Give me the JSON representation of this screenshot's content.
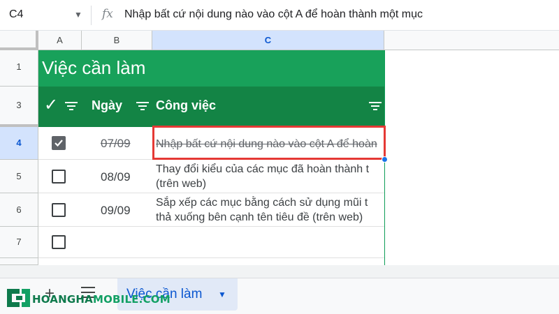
{
  "formula_bar": {
    "cell_ref": "C4",
    "fx_symbol": "fx",
    "content": "Nhập bất cứ nội dung nào vào cột A để hoàn thành một mục"
  },
  "columns": [
    "A",
    "B",
    "C"
  ],
  "rows": [
    "1",
    "3",
    "4",
    "5",
    "6",
    "7"
  ],
  "sheet": {
    "title": "Việc cần làm",
    "headers": {
      "check": "✓",
      "date": "Ngày",
      "task": "Công việc"
    },
    "tasks": [
      {
        "row": "4",
        "done": true,
        "date": "07/09",
        "task": "Nhập bất cứ nội dung nào vào cột A để hoàn"
      },
      {
        "row": "5",
        "done": false,
        "date": "08/09",
        "task_line1": "Thay đổi kiểu của các mục đã hoàn thành t",
        "task_line2": "(trên web)"
      },
      {
        "row": "6",
        "done": false,
        "date": "09/09",
        "task_line1": "Sắp xếp các mục bằng cách sử dụng mũi t",
        "task_line2": "thả xuống bên cạnh tên tiêu đề (trên web)"
      },
      {
        "row": "7",
        "done": false,
        "date": "",
        "task": ""
      }
    ]
  },
  "bottom_bar": {
    "add_icon": "plus-icon",
    "list_icon": "menu-icon",
    "active_sheet": "Việc cần làm"
  },
  "watermark": {
    "part1": "HOANGHA",
    "part2": "MOBILE.COM"
  },
  "colors": {
    "title_green": "#18a15a",
    "header_green": "#138445",
    "selection_red": "#e53935",
    "accent_blue": "#0b57d0"
  }
}
